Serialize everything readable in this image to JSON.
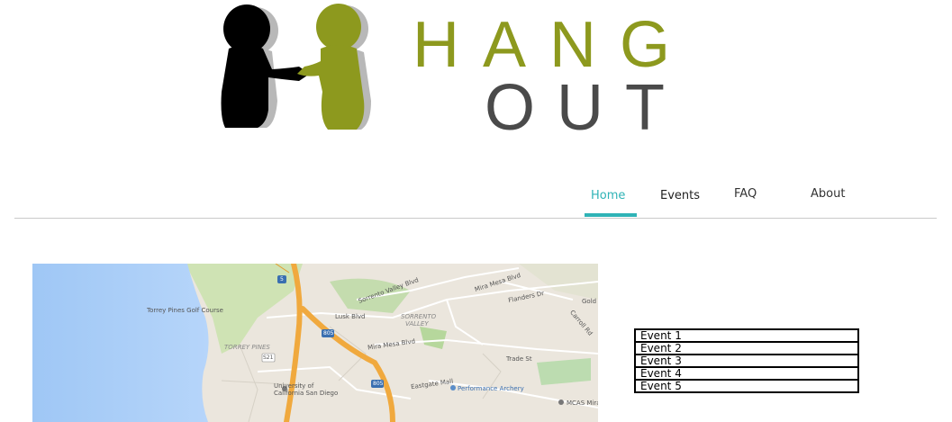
{
  "logo": {
    "word_top": "HANG",
    "word_bottom": "OUT",
    "colors": {
      "olive": "#8d991e",
      "dark": "#4a4a4a",
      "figure_dark": "#000000",
      "shadow": "#b5b5b5"
    }
  },
  "nav": {
    "items": [
      {
        "label": "Home",
        "active": true
      },
      {
        "label": "Events",
        "active": false
      },
      {
        "label": "FAQ",
        "active": false
      },
      {
        "label": "About",
        "active": false
      }
    ],
    "accent_color": "#2fb3b6"
  },
  "map": {
    "labels": {
      "torrey_pines_golf": "Torrey Pines Golf Course",
      "torrey_pines": "TORREY PINES",
      "ucsd_line1": "University of",
      "ucsd_line2": "California San Diego",
      "sorrento_valley_line1": "SORRENTO",
      "sorrento_valley_line2": "VALLEY",
      "sorrento_valley_blvd": "Sorrento Valley Blvd",
      "mira_mesa_blvd_top": "Mira Mesa Blvd",
      "mira_mesa_blvd_mid": "Mira Mesa Blvd",
      "lusk_blvd": "Lusk Blvd",
      "flanders_dr": "Flanders Dr",
      "trade_st": "Trade St",
      "performance_archery": "Performance Archery",
      "mcas_miramar": "MCAS Mirar",
      "eastgate_mall": "Eastgate Mall",
      "hwy_805_a": "805",
      "hwy_805_b": "805",
      "hwy_5": "5",
      "hwy_s21": "S21",
      "gold": "Gold",
      "carroll_rd": "Carroll Rd"
    }
  },
  "events": [
    "Event 1",
    "Event 2",
    "Event 3",
    "Event 4",
    "Event 5"
  ]
}
